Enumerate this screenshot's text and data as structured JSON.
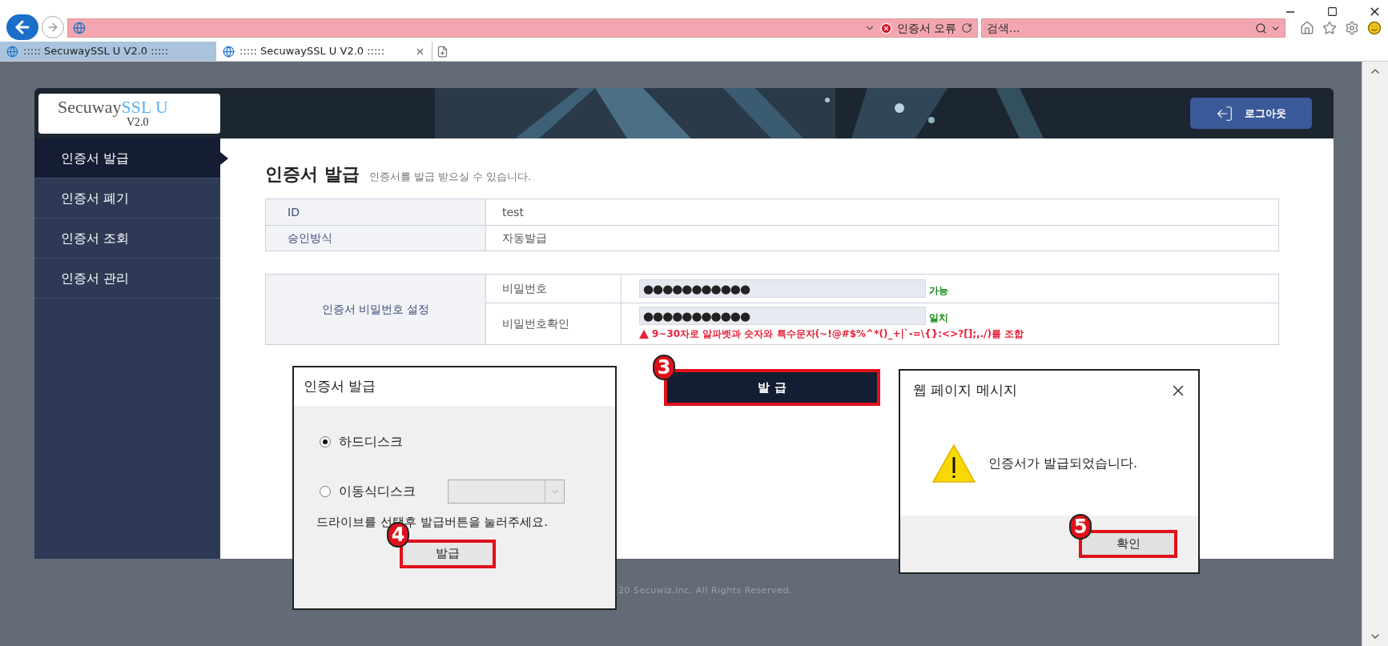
{
  "browser": {
    "address": {
      "error_label": "인증서 오류"
    },
    "search": {
      "placeholder": "검색..."
    },
    "tabs": [
      {
        "label": "::::: SecuwaySSL U V2.0 :::::",
        "selected": false
      },
      {
        "label": "::::: SecuwaySSL U V2.0 :::::",
        "selected": true
      }
    ]
  },
  "header": {
    "logo": {
      "name": "Secuway",
      "accent": "SSL U",
      "version": "V2.0"
    },
    "logout": "로그아웃"
  },
  "sidebar": {
    "items": [
      {
        "label": "인증서 발급",
        "selected": true
      },
      {
        "label": "인증서 폐기",
        "selected": false
      },
      {
        "label": "인증서 조회",
        "selected": false
      },
      {
        "label": "인증서 관리",
        "selected": false
      }
    ]
  },
  "page": {
    "title": "인증서 발급",
    "subtitle": "인증서를 발급 받으실 수 있습니다.",
    "info": [
      {
        "label": "ID",
        "value": "test"
      },
      {
        "label": "승인방식",
        "value": "자동발급"
      }
    ],
    "password": {
      "group_label": "인증서 비밀번호 설정",
      "rows": [
        {
          "label": "비밀번호",
          "value": "●●●●●●●●●●●",
          "status": "가능"
        },
        {
          "label": "비밀번호확인",
          "value": "●●●●●●●●●●●",
          "status": "일치"
        }
      ],
      "hint": "9~30자로 알파벳과 숫자와 특수문자(~!@#$%^*()_+|`-=\\{}:<>?[];,./)를 조합"
    },
    "issue_button": {
      "label": "발 급",
      "highlighted": true,
      "step": "3"
    }
  },
  "footer": "20 Secuwiz,Inc. All Rights Reserved.",
  "issue_dialog": {
    "title": "인증서 발급",
    "options": [
      {
        "label": "하드디스크",
        "selected": true
      },
      {
        "label": "이동식디스크",
        "selected": false
      }
    ],
    "instruction": "드라이브를 선택후 발급버튼을 눌러주세요.",
    "button": {
      "label": "발급",
      "highlighted": true,
      "step": "4"
    }
  },
  "message_dialog": {
    "title": "웹 페이지 메시지",
    "message": "인증서가 발급되었습니다.",
    "button": {
      "label": "확인",
      "highlighted": true,
      "step": "5"
    }
  }
}
